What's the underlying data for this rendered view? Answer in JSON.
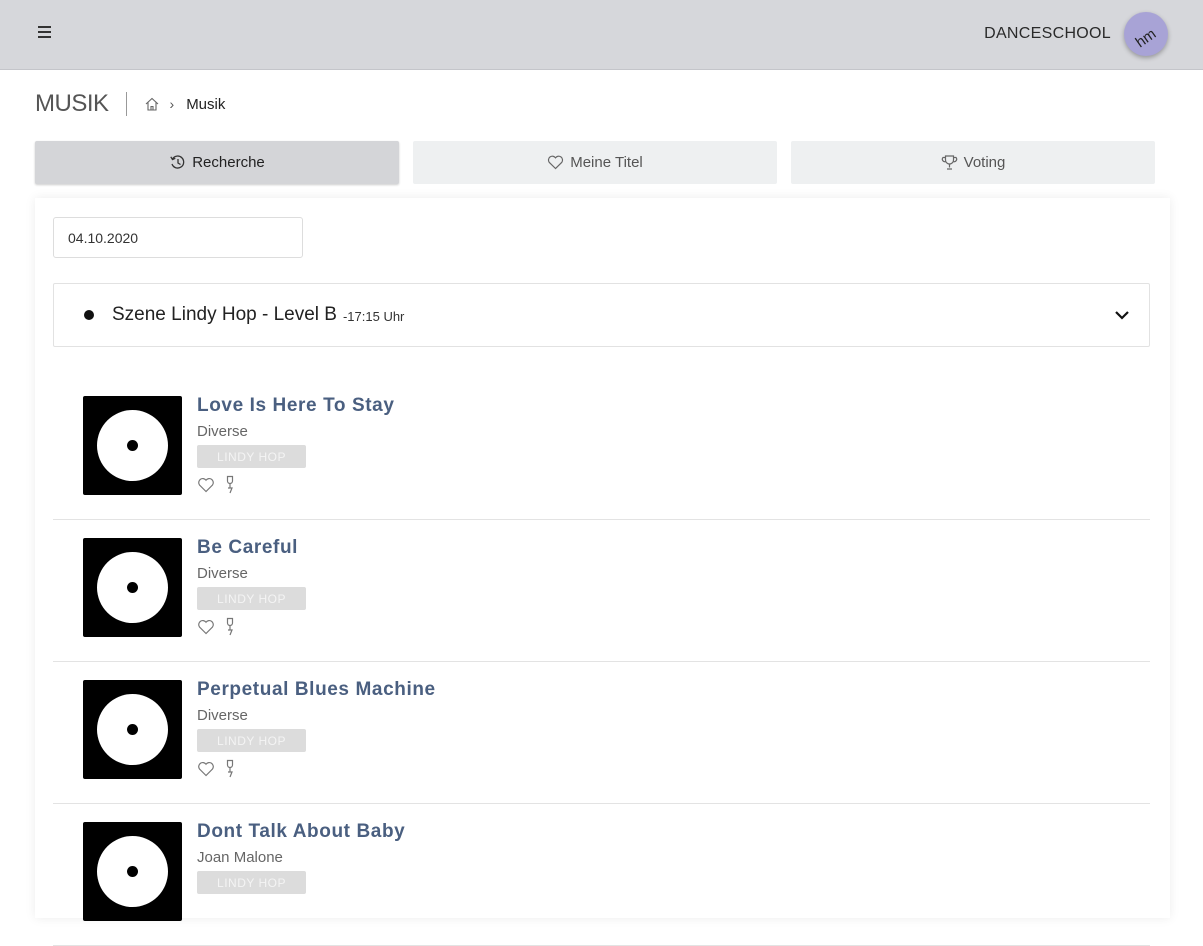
{
  "header": {
    "brand": "DANCESCHOOL",
    "avatar_text": "hm"
  },
  "page": {
    "title": "MUSIK",
    "breadcrumb_current": "Musik"
  },
  "tabs": [
    {
      "label": "Recherche",
      "icon": "history-icon",
      "active": true
    },
    {
      "label": "Meine Titel",
      "icon": "heart-icon",
      "active": false
    },
    {
      "label": "Voting",
      "icon": "trophy-icon",
      "active": false
    }
  ],
  "filter": {
    "date_value": "04.10.2020"
  },
  "session": {
    "name": "Szene Lindy Hop - Level B",
    "time": "-17:15 Uhr"
  },
  "tracks": [
    {
      "title": "Love Is Here To Stay",
      "artist": "Diverse",
      "tag": "LINDY HOP"
    },
    {
      "title": "Be Careful",
      "artist": "Diverse",
      "tag": "LINDY HOP"
    },
    {
      "title": "Perpetual Blues Machine",
      "artist": "Diverse",
      "tag": "LINDY HOP"
    },
    {
      "title": "Dont Talk About Baby",
      "artist": "Joan Malone",
      "tag": "LINDY HOP"
    }
  ],
  "colors": {
    "topbar": "#d6d7db",
    "avatar": "#a8a3d6",
    "track_title": "#4a5f80"
  }
}
